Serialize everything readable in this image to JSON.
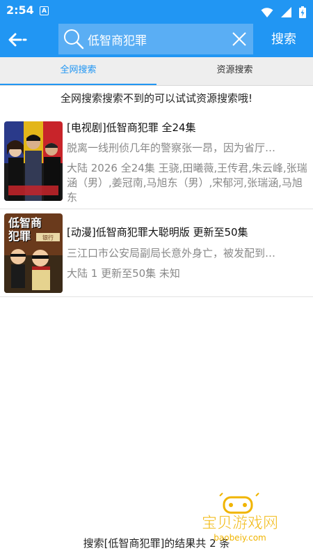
{
  "status_bar": {
    "time": "2:54",
    "app_icon_letter": "A",
    "icons": [
      "wifi-icon",
      "signal-icon",
      "battery-charging-icon"
    ]
  },
  "toolbar": {
    "search_value": "低智商犯罪",
    "search_button_label": "搜索",
    "back_icon": "back-arrow-icon",
    "clear_icon": "close-icon"
  },
  "tabs": [
    {
      "label": "全网搜索",
      "active": true
    },
    {
      "label": "资源搜索",
      "active": false
    }
  ],
  "hint": "全网搜索搜索不到的可以试试资源搜索哦!",
  "results": [
    {
      "title": "[电视剧]低智商犯罪 全24集",
      "description": "脱离一线刑侦几年的警察张一昂，因为省厅…",
      "meta": "大陆 2026 全24集 王骁,田曦薇,王传君,朱云峰,张瑞涵（男）,姜冠南,马旭东（男）,宋郁河,张瑞涵,马旭东"
    },
    {
      "title": "[动漫]低智商犯罪大聪明版 更新至50集",
      "description": "三江口市公安局副局长意外身亡，被发配到…",
      "meta": "大陆 1 更新至50集 未知",
      "poster_text": "低智商犯罪",
      "poster_sign": "银行"
    }
  ],
  "footer": "搜索[低智商犯罪]的结果共 2 条",
  "watermark": {
    "text": "宝贝游戏网",
    "url": "baobeiy.com"
  },
  "colors": {
    "primary": "#2196f3",
    "search_box": "#5aaef4",
    "tab_bar": "#eeeeee",
    "watermark": "#f0b400"
  }
}
